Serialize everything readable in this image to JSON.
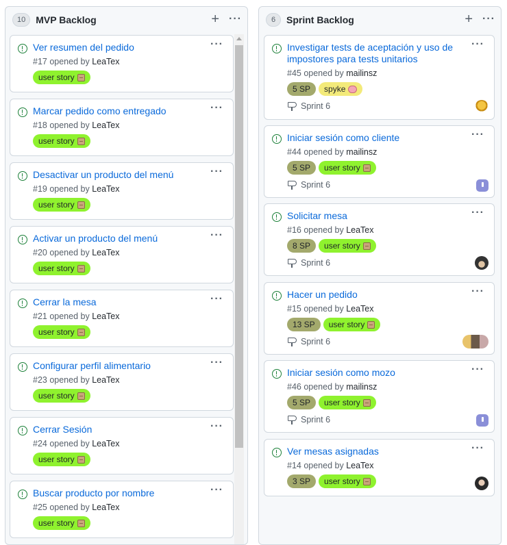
{
  "columns": [
    {
      "title": "MVP Backlog",
      "count": "10",
      "cards": [
        {
          "title": "Ver resumen del pedido",
          "meta": "#17 opened by ",
          "author": "LeaTex",
          "labels": [
            {
              "text": "user story",
              "kind": "us"
            }
          ]
        },
        {
          "title": "Marcar pedido como entregado",
          "meta": "#18 opened by ",
          "author": "LeaTex",
          "labels": [
            {
              "text": "user story",
              "kind": "us"
            }
          ]
        },
        {
          "title": "Desactivar un producto del menú",
          "meta": "#19 opened by ",
          "author": "LeaTex",
          "labels": [
            {
              "text": "user story",
              "kind": "us"
            }
          ]
        },
        {
          "title": "Activar un producto del menú",
          "meta": "#20 opened by ",
          "author": "LeaTex",
          "labels": [
            {
              "text": "user story",
              "kind": "us"
            }
          ]
        },
        {
          "title": "Cerrar la mesa",
          "meta": "#21 opened by ",
          "author": "LeaTex",
          "labels": [
            {
              "text": "user story",
              "kind": "us"
            }
          ]
        },
        {
          "title": "Configurar perfil alimentario",
          "meta": "#23 opened by ",
          "author": "LeaTex",
          "labels": [
            {
              "text": "user story",
              "kind": "us"
            }
          ]
        },
        {
          "title": "Cerrar Sesión",
          "meta": "#24 opened by ",
          "author": "LeaTex",
          "labels": [
            {
              "text": "user story",
              "kind": "us"
            }
          ]
        },
        {
          "title": "Buscar producto por nombre",
          "meta": "#25 opened by ",
          "author": "LeaTex",
          "labels": [
            {
              "text": "user story",
              "kind": "us"
            }
          ]
        }
      ]
    },
    {
      "title": "Sprint Backlog",
      "count": "6",
      "cards": [
        {
          "title": "Investigar tests de aceptación y uso de impostores para tests unitarios",
          "meta": "#45 opened by ",
          "author": "mailinsz",
          "labels": [
            {
              "text": "5 SP",
              "kind": "sp"
            },
            {
              "text": "spyke",
              "kind": "spyke"
            }
          ],
          "sprint": "Sprint 6",
          "avatar": "yellow"
        },
        {
          "title": "Iniciar sesión como cliente",
          "meta": "#44 opened by ",
          "author": "mailinsz",
          "labels": [
            {
              "text": "5 SP",
              "kind": "sp"
            },
            {
              "text": "user story",
              "kind": "us"
            }
          ],
          "sprint": "Sprint 6",
          "avatar": "purple"
        },
        {
          "title": "Solicitar mesa",
          "meta": "#16 opened by ",
          "author": "LeaTex",
          "labels": [
            {
              "text": "8 SP",
              "kind": "sp"
            },
            {
              "text": "user story",
              "kind": "us"
            }
          ],
          "sprint": "Sprint 6",
          "avatar": "dark"
        },
        {
          "title": "Hacer un pedido",
          "meta": "#15 opened by ",
          "author": "LeaTex",
          "labels": [
            {
              "text": "13 SP",
              "kind": "sp"
            },
            {
              "text": "user story",
              "kind": "us"
            }
          ],
          "sprint": "Sprint 6",
          "avatar": "pair"
        },
        {
          "title": "Iniciar sesión como mozo",
          "meta": "#46 opened by ",
          "author": "mailinsz",
          "labels": [
            {
              "text": "5 SP",
              "kind": "sp"
            },
            {
              "text": "user story",
              "kind": "us"
            }
          ],
          "sprint": "Sprint 6",
          "avatar": "purple"
        },
        {
          "title": "Ver mesas asignadas",
          "meta": "#14 opened by ",
          "author": "LeaTex",
          "labels": [
            {
              "text": "3 SP",
              "kind": "sp"
            },
            {
              "text": "user story",
              "kind": "us"
            }
          ],
          "avatar": "face"
        }
      ]
    }
  ],
  "icons": {
    "add": "plus-icon",
    "menu": "kebab-menu-icon",
    "issue": "issue-open-icon",
    "milestone": "milestone-icon"
  },
  "colors": {
    "user_story_label": "#8ff22e",
    "story_points_label": "#a3a96c",
    "spyke_label": "#f3ea7a",
    "issue_open": "#1a7f37",
    "link": "#0969da"
  }
}
